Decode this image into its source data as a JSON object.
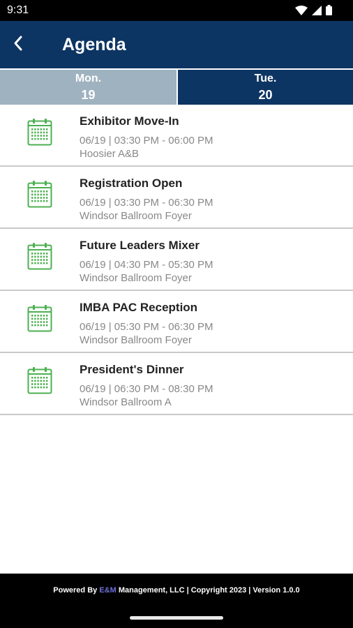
{
  "status_bar": {
    "time": "9:31",
    "icons": [
      "wifi-icon",
      "signal-icon",
      "battery-icon"
    ]
  },
  "app_bar": {
    "back_icon": "chevron-left-icon",
    "title": "Agenda"
  },
  "day_tabs": [
    {
      "day": "Mon.",
      "date": "19",
      "selected": false
    },
    {
      "day": "Tue.",
      "date": "20",
      "selected": true
    }
  ],
  "agenda": [
    {
      "title": "Exhibitor Move-In",
      "time": "06/19 | 03:30 PM - 06:00 PM",
      "location": "Hoosier A&B"
    },
    {
      "title": "Registration Open",
      "time": "06/19 | 03:30 PM - 06:30 PM",
      "location": "Windsor Ballroom Foyer"
    },
    {
      "title": "Future Leaders Mixer",
      "time": "06/19 | 04:30 PM - 05:30 PM",
      "location": "Windsor Ballroom Foyer"
    },
    {
      "title": "IMBA PAC Reception",
      "time": "06/19 | 05:30 PM - 06:30 PM",
      "location": "Windsor Ballroom Foyer"
    },
    {
      "title": "President's Dinner",
      "time": "06/19 | 06:30 PM - 08:30 PM",
      "location": "Windsor Ballroom A"
    }
  ],
  "footer": {
    "prefix": "Powered By ",
    "brand": "E&M",
    "suffix": " Management, LLC | Copyright 2023 | Version 1.0.0"
  },
  "colors": {
    "primary": "#0d3563",
    "tab_inactive": "#9fb2c0",
    "icon_green": "#4cb050",
    "brand": "#6f6fd8"
  }
}
